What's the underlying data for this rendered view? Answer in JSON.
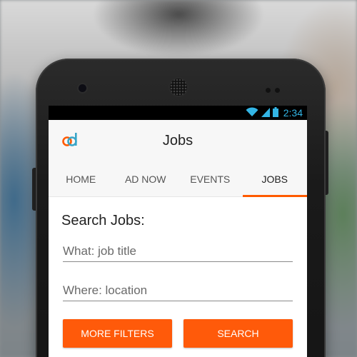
{
  "status_bar": {
    "time": "2:34",
    "icons": [
      "wifi-icon",
      "signal-icon",
      "battery-icon"
    ],
    "icon_color": "#33b5e5"
  },
  "app_bar": {
    "title": "Jobs",
    "logo_colors": [
      "#ff5a00",
      "#3aa6c8"
    ]
  },
  "tabs": [
    {
      "label": "HOME",
      "active": false
    },
    {
      "label": "AD NOW",
      "active": false
    },
    {
      "label": "EVENTS",
      "active": false
    },
    {
      "label": "JOBS",
      "active": true
    }
  ],
  "search_form": {
    "heading": "Search Jobs:",
    "what_placeholder": "What: job title",
    "what_value": "",
    "where_placeholder": "Where: location",
    "where_value": "",
    "more_filters_label": "MORE FILTERS",
    "search_label": "SEARCH"
  },
  "colors": {
    "accent": "#ff5a00",
    "button": "#ff5a0a"
  }
}
